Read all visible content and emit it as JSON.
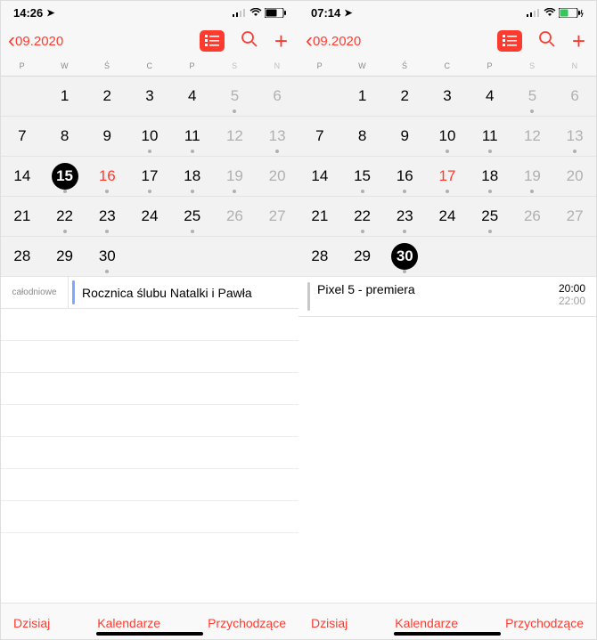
{
  "left": {
    "status_time": "14:26",
    "month_label": "09.2020",
    "weekdays": [
      "P",
      "W",
      "Ś",
      "C",
      "P",
      "S",
      "N"
    ],
    "weeks": [
      [
        {
          "n": ""
        },
        {
          "n": "1"
        },
        {
          "n": "2"
        },
        {
          "n": "3"
        },
        {
          "n": "4"
        },
        {
          "n": "5",
          "we": true,
          "dot": true
        },
        {
          "n": "6",
          "we": true
        }
      ],
      [
        {
          "n": "7"
        },
        {
          "n": "8"
        },
        {
          "n": "9"
        },
        {
          "n": "10",
          "dot": true
        },
        {
          "n": "11",
          "dot": true
        },
        {
          "n": "12",
          "we": true
        },
        {
          "n": "13",
          "we": true,
          "dot": true
        }
      ],
      [
        {
          "n": "14"
        },
        {
          "n": "15",
          "sel": true,
          "dot": true
        },
        {
          "n": "16",
          "today": true,
          "dot": true
        },
        {
          "n": "17",
          "dot": true
        },
        {
          "n": "18",
          "dot": true
        },
        {
          "n": "19",
          "we": true,
          "dot": true
        },
        {
          "n": "20",
          "we": true
        }
      ],
      [
        {
          "n": "21"
        },
        {
          "n": "22",
          "dot": true
        },
        {
          "n": "23",
          "dot": true
        },
        {
          "n": "24"
        },
        {
          "n": "25",
          "dot": true
        },
        {
          "n": "26",
          "we": true
        },
        {
          "n": "27",
          "we": true
        }
      ],
      [
        {
          "n": "28"
        },
        {
          "n": "29"
        },
        {
          "n": "30",
          "dot": true
        },
        {
          "n": ""
        },
        {
          "n": ""
        },
        {
          "n": ""
        },
        {
          "n": ""
        }
      ]
    ],
    "allday_label": "całodniowe",
    "event_title": "Rocznica ślubu Natalki i Pawła",
    "today_btn": "Dzisiaj",
    "calendars_btn": "Kalendarze",
    "incoming_btn": "Przychodzące"
  },
  "right": {
    "status_time": "07:14",
    "month_label": "09.2020",
    "weekdays": [
      "P",
      "W",
      "Ś",
      "C",
      "P",
      "S",
      "N"
    ],
    "weeks": [
      [
        {
          "n": ""
        },
        {
          "n": "1"
        },
        {
          "n": "2"
        },
        {
          "n": "3"
        },
        {
          "n": "4"
        },
        {
          "n": "5",
          "we": true,
          "dot": true
        },
        {
          "n": "6",
          "we": true
        }
      ],
      [
        {
          "n": "7"
        },
        {
          "n": "8"
        },
        {
          "n": "9"
        },
        {
          "n": "10",
          "dot": true
        },
        {
          "n": "11",
          "dot": true
        },
        {
          "n": "12",
          "we": true
        },
        {
          "n": "13",
          "we": true,
          "dot": true
        }
      ],
      [
        {
          "n": "14"
        },
        {
          "n": "15",
          "dot": true
        },
        {
          "n": "16",
          "dot": true
        },
        {
          "n": "17",
          "today": true,
          "dot": true
        },
        {
          "n": "18",
          "dot": true
        },
        {
          "n": "19",
          "we": true,
          "dot": true
        },
        {
          "n": "20",
          "we": true
        }
      ],
      [
        {
          "n": "21"
        },
        {
          "n": "22",
          "dot": true
        },
        {
          "n": "23",
          "dot": true
        },
        {
          "n": "24"
        },
        {
          "n": "25",
          "dot": true
        },
        {
          "n": "26",
          "we": true
        },
        {
          "n": "27",
          "we": true
        }
      ],
      [
        {
          "n": "28"
        },
        {
          "n": "29"
        },
        {
          "n": "30",
          "sel": true,
          "dot": true
        },
        {
          "n": ""
        },
        {
          "n": ""
        },
        {
          "n": ""
        },
        {
          "n": ""
        }
      ]
    ],
    "event_title": "Pixel 5 - premiera",
    "event_start": "20:00",
    "event_end": "22:00",
    "today_btn": "Dzisiaj",
    "calendars_btn": "Kalendarze",
    "incoming_btn": "Przychodzące"
  }
}
